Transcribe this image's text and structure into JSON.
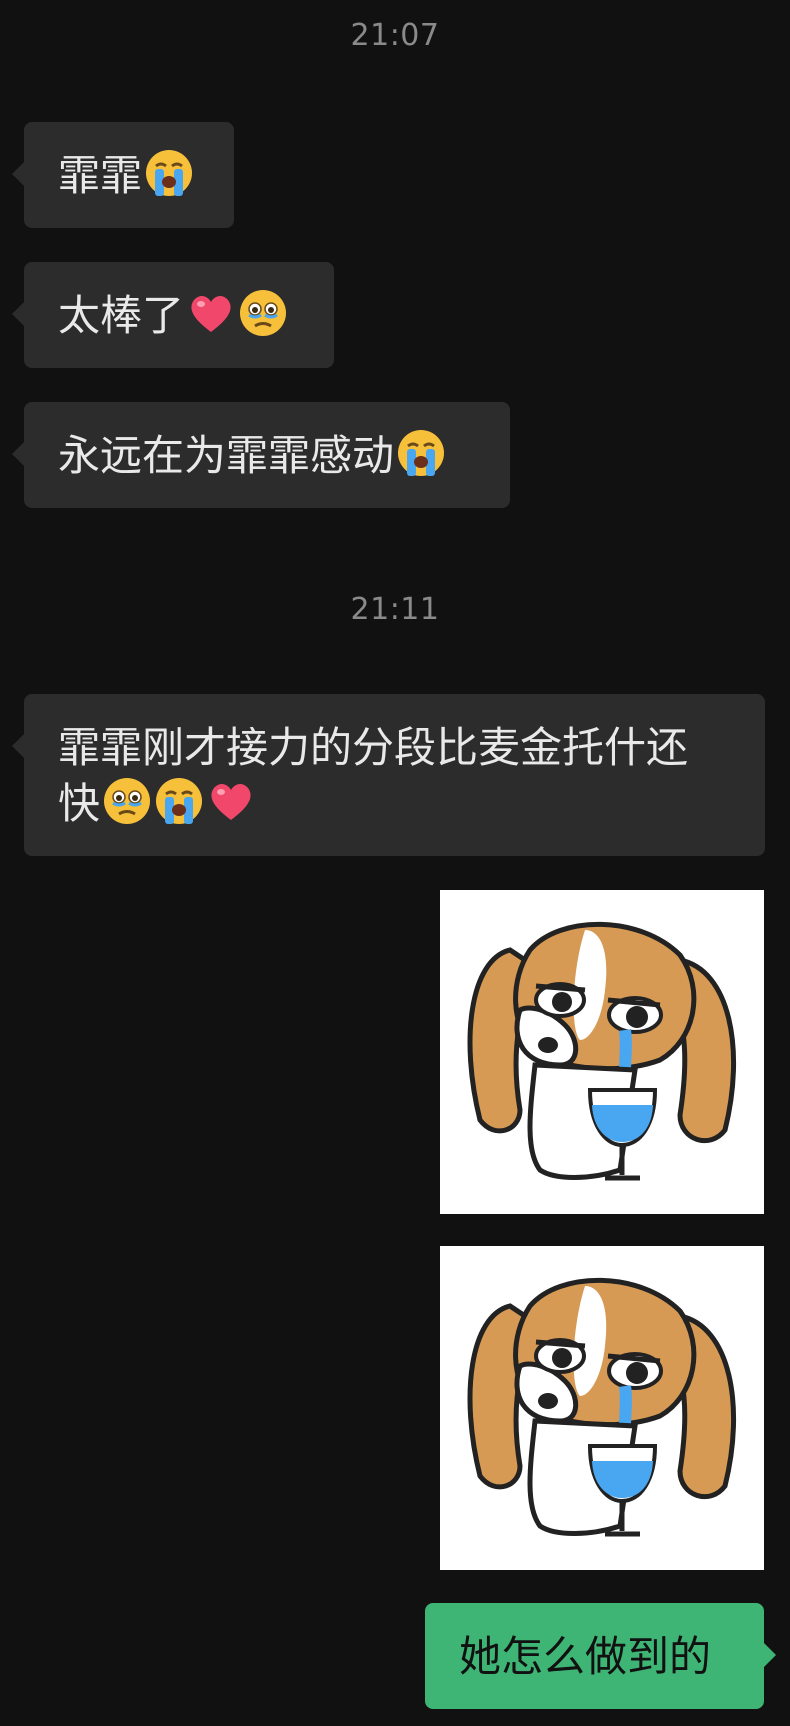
{
  "chat": {
    "timestamps": [
      "21:07",
      "21:11"
    ],
    "messages": [
      {
        "direction": "in",
        "text": "霏霏",
        "emojis": [
          "loudly-crying-face-emoji"
        ]
      },
      {
        "direction": "in",
        "text": "太棒了",
        "emojis": [
          "red-heart-emoji",
          "holding-back-tears-emoji"
        ]
      },
      {
        "direction": "in",
        "text": "永远在为霏霏感动",
        "emojis": [
          "loudly-crying-face-emoji"
        ]
      },
      {
        "direction": "in",
        "text_line1": "霏霏刚才接力的分段比麦金托什还",
        "text_line2": "快",
        "emojis": [
          "holding-back-tears-emoji",
          "loudly-crying-face-emoji",
          "red-heart-emoji"
        ]
      },
      {
        "direction": "out",
        "type": "sticker",
        "sticker": "crying-beagle-with-glass-sticker"
      },
      {
        "direction": "out",
        "type": "sticker",
        "sticker": "crying-beagle-with-glass-sticker"
      },
      {
        "direction": "out",
        "text": "她怎么做到的"
      }
    ]
  },
  "colors": {
    "background": "#111111",
    "incoming_bubble": "#2c2c2c",
    "outgoing_bubble": "#3eb575",
    "timestamp_text": "#8a8a8a"
  }
}
